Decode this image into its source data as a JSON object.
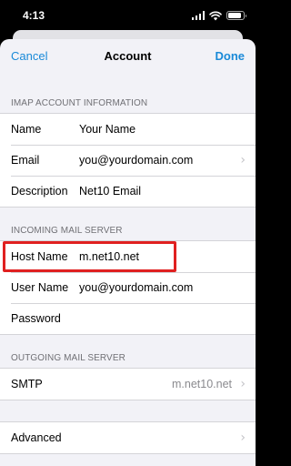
{
  "status_bar": {
    "time": "4:13",
    "icons": [
      "signal-icon",
      "wifi-icon",
      "battery-icon"
    ],
    "battery_level": 0.85
  },
  "nav": {
    "cancel_label": "Cancel",
    "title": "Account",
    "done_label": "Done"
  },
  "imap": {
    "header": "IMAP ACCOUNT INFORMATION",
    "rows": [
      {
        "label": "Name",
        "value": "Your Name"
      },
      {
        "label": "Email",
        "value": "you@yourdomain.com"
      },
      {
        "label": "Description",
        "value": "Net10 Email"
      }
    ]
  },
  "incoming": {
    "header": "INCOMING MAIL SERVER",
    "rows": [
      {
        "label": "Host Name",
        "value": "m.net10.net"
      },
      {
        "label": "User Name",
        "value": "you@yourdomain.com"
      },
      {
        "label": "Password",
        "value": ""
      }
    ]
  },
  "outgoing": {
    "header": "OUTGOING MAIL SERVER",
    "smtp_label": "SMTP",
    "smtp_value": "m.net10.net"
  },
  "advanced": {
    "label": "Advanced"
  },
  "colors": {
    "accent": "#1a8ad8",
    "highlight": "#e02020",
    "background": "#f2f2f7"
  }
}
